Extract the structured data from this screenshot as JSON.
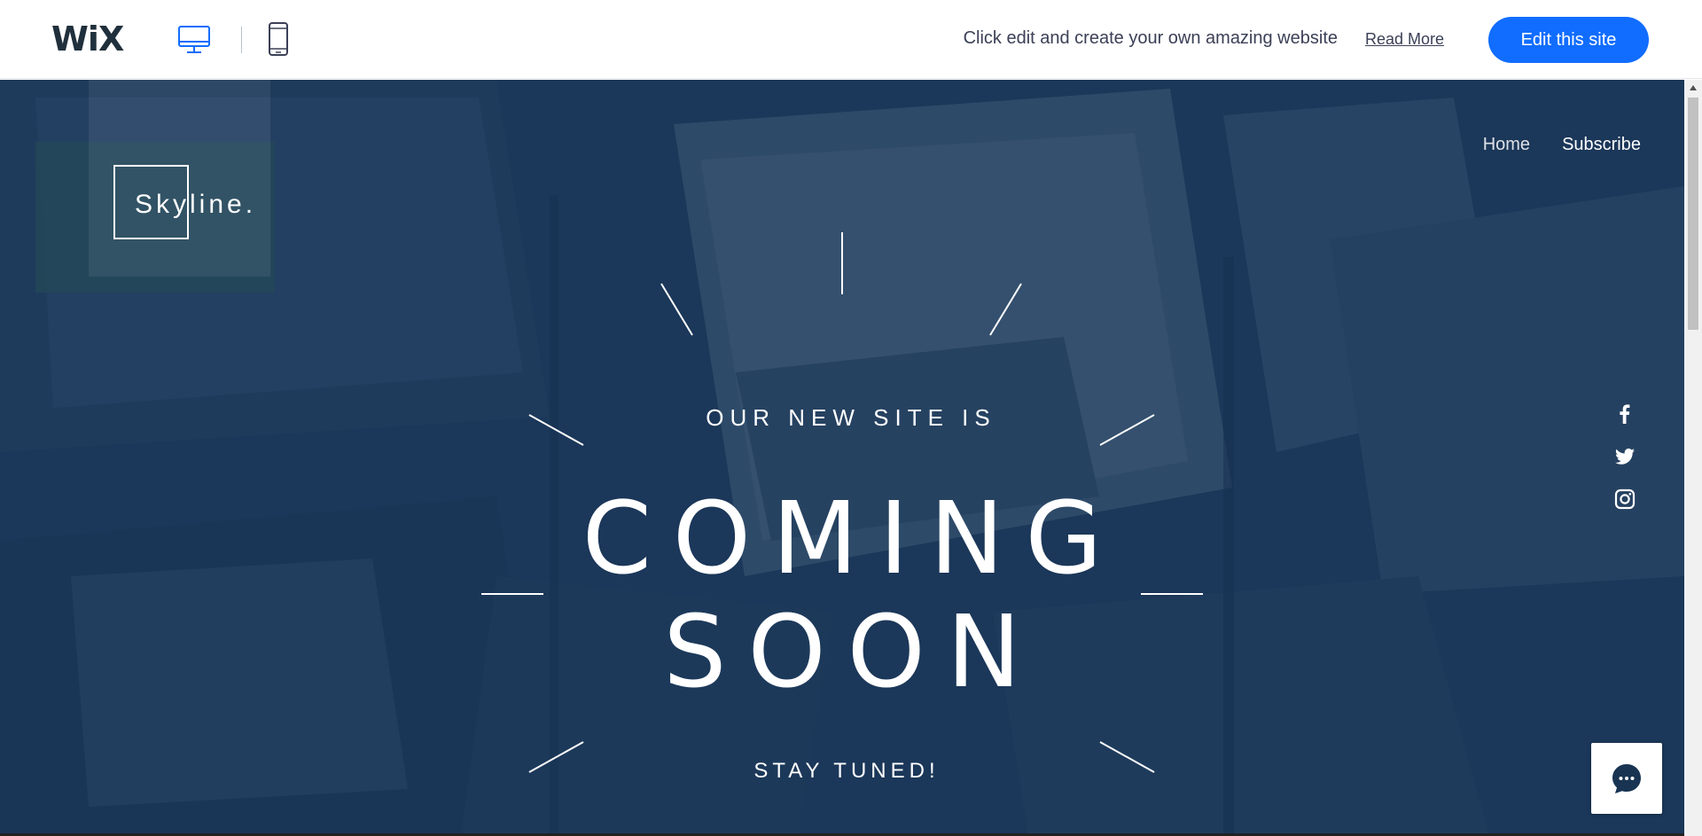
{
  "wix_bar": {
    "logo": "WiX",
    "desktop_icon": "desktop-monitor-icon",
    "mobile_icon": "mobile-phone-icon",
    "message": "Click edit and create your own amazing website",
    "read_more": "Read More",
    "edit_button": "Edit this site",
    "accent_color": "#116dff"
  },
  "site": {
    "logo_text": "Skyline.",
    "nav": {
      "items": [
        {
          "label": "Home"
        },
        {
          "label": "Subscribe"
        }
      ]
    },
    "social": [
      "facebook-icon",
      "twitter-icon",
      "instagram-icon"
    ],
    "hero": {
      "pre_title": "OUR NEW SITE IS",
      "title_line1": "COMING",
      "title_line2": "SOON",
      "post_title": "STAY TUNED!"
    },
    "chat_icon": "chat-bubble-icon",
    "overlay_color": "#1c3857"
  }
}
